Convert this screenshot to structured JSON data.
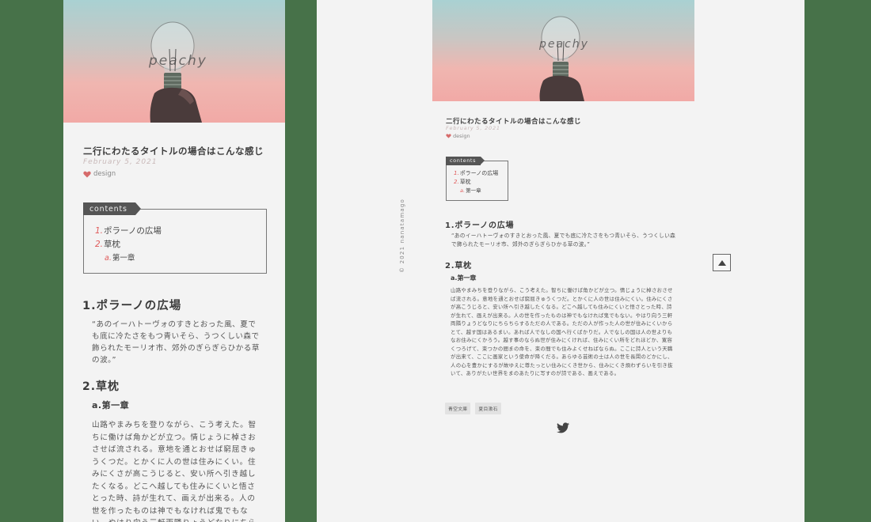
{
  "theme": {
    "outer_bg": "#477249",
    "panel_bg": "#f3f3f3",
    "accent": "#e05a5a"
  },
  "blog": {
    "logo": "peachy",
    "credit": "© 2021 nanatamago"
  },
  "post": {
    "title": "二行にわたるタイトルの場合はこんな感じ",
    "date": "February 5, 2021",
    "category": "design",
    "category_icon": "heart-icon"
  },
  "toc": {
    "label": "contents",
    "items": [
      {
        "num": "1.",
        "text": "ポラーノの広場"
      },
      {
        "num": "2.",
        "text": "草枕"
      },
      {
        "num": "a.",
        "text": "第一章"
      }
    ]
  },
  "sections": {
    "h1": "1.ポラーノの広場",
    "quote": "“あのイーハトーヴォのすきとおった風、夏でも底に冷たさをもつ青いそら、うつくしい森で飾られたモーリオ市、郊外のぎらぎらひかる草の波。”",
    "h2": "2.草枕",
    "h3": "a.第一章",
    "body_mobile": "山路やまみちを登りながら、こう考えた。智ちに働けば角かどが立つ。情じょうに棹さおさせば流される。意地を通とおせば窮屈きゅうくつだ。とかくに人の世は住みにくい。住みにくさが高こうじると、安い所へ引き越したくなる。どこへ越しても住みにくいと悟さとった時、詩が生れて、画えが出来る。人の世を作ったものは神でもなければ鬼でもない。やはり向う三軒両隣りょうどなりにちらちらするただの人である。ただの人が作った",
    "body_desktop": "山路やまみちを登りながら、こう考えた。智ちに働けば角かどが立つ。情じょうに棹さおさせば流される。意地を通とおせば窮屈きゅうくつだ。とかくに人の世は住みにくい。住みにくさが高こうじると、安い所へ引き越したくなる。どこへ越しても住みにくいと悟さとった時、詩が生れて、画えが出来る。人の世を作ったものは神でもなければ鬼でもない。やはり向う三軒両隣りょうどなりにちらちらするただの人である。ただの人が作った人の世が住みにくいからとて、越す国はあるまい。あれば人でなしの国へ行くばかりだ。人でなしの国は人の世よりもなお住みにくかろう。越す事のならぬ世が住みにくければ、住みにくい所をどれほどか、寛容くつろげて、束つかの間まの命を、束の間でも住みよくせねばならぬ。ここに詩人という天職が出来て、ここに画家という使命が降くだる。あらゆる芸術の士は人の世を長閑のどかにし、人の心を豊かにするが故ゆえに尊たっとい住みにくき世から、住みにくき煩わずらいを引き抜いて、ありがたい世界をまのあたりに写すのが詩である、画えである。"
  },
  "tags": [
    "青空文庫",
    "夏目漱石"
  ],
  "footer": {
    "share_icon": "twitter-icon",
    "top_icon": "arrow-up-icon"
  }
}
